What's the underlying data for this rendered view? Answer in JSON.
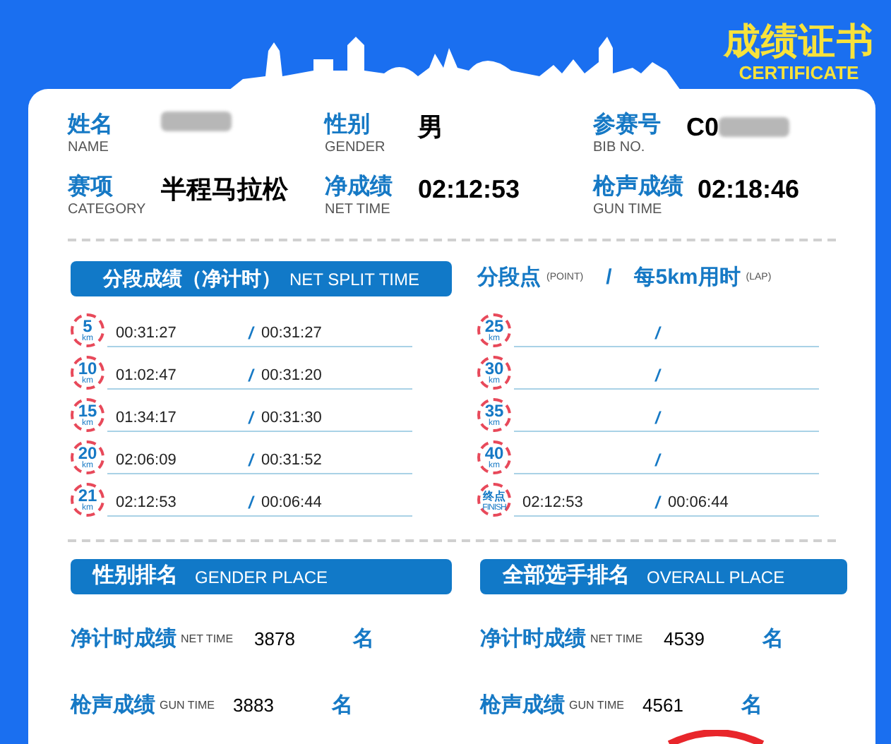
{
  "certificate": {
    "title": "成绩证书",
    "subtitle": "CERTIFICATE"
  },
  "info": [
    {
      "label": "姓名",
      "label_en": "NAME",
      "redacted": true
    },
    {
      "label": "性别",
      "label_en": "GENDER",
      "value": "男",
      "redacted": false
    },
    {
      "label": "参赛号",
      "label_en": "BIB NO.",
      "value": "C0",
      "redacted": true
    },
    {
      "label": "赛项",
      "label_en": "CATEGORY",
      "value": "半程马拉松",
      "redacted": false
    },
    {
      "label": "净成绩",
      "label_en": "NET TIME",
      "value": "02:12:53",
      "redacted": false
    },
    {
      "label": "枪声成绩",
      "label_en": "GUN TIME",
      "value": "02:18:46",
      "redacted": false
    }
  ],
  "splits_left": {
    "title": "分段成绩（净计时）",
    "title_en": "NET SPLIT TIME",
    "rows": [
      {
        "badge": "5",
        "unit": "km",
        "time": "00:31:27",
        "slash": "/",
        "lap": "00:31:27"
      },
      {
        "badge": "10",
        "unit": "km",
        "time": "01:02:47",
        "slash": "/",
        "lap": "00:31:20"
      },
      {
        "badge": "15",
        "unit": "km",
        "time": "01:34:17",
        "slash": "/",
        "lap": "00:31:30"
      },
      {
        "badge": "20",
        "unit": "km",
        "time": "02:06:09",
        "slash": "/",
        "lap": "00:31:52"
      },
      {
        "badge": "21",
        "unit": "km",
        "time": "02:12:53",
        "slash": "/",
        "lap": "00:06:44"
      }
    ]
  },
  "splits_right": {
    "point": "分段点",
    "point_en": "(POINT)",
    "divider": "/",
    "lap_title": "每5km用时",
    "lap_en": "(LAP)",
    "rows": [
      {
        "badge": "25",
        "unit": "km",
        "slash": "/"
      },
      {
        "badge": "30",
        "unit": "km",
        "slash": "/"
      },
      {
        "badge": "35",
        "unit": "km",
        "slash": "/"
      },
      {
        "badge": "40",
        "unit": "km",
        "slash": "/"
      },
      {
        "badge": "终点",
        "unit": "FINISH",
        "time": "02:12:53",
        "slash": "/",
        "lap": "00:06:44"
      }
    ]
  },
  "rankings": [
    {
      "title": "性别排名",
      "title_en": "GENDER PLACE",
      "rows": [
        {
          "label": "净计时成绩",
          "label_en": "NET TIME",
          "value": "3878",
          "unit": "名"
        },
        {
          "label": "枪声成绩",
          "label_en": "GUN TIME",
          "value": "3883",
          "unit": "名"
        }
      ]
    },
    {
      "title": "全部选手排名",
      "title_en": "OVERALL PLACE",
      "rows": [
        {
          "label": "净计时成绩",
          "label_en": "NET TIME",
          "value": "4539",
          "unit": "名"
        },
        {
          "label": "枪声成绩",
          "label_en": "GUN TIME",
          "value": "4561",
          "unit": "名"
        }
      ]
    }
  ]
}
